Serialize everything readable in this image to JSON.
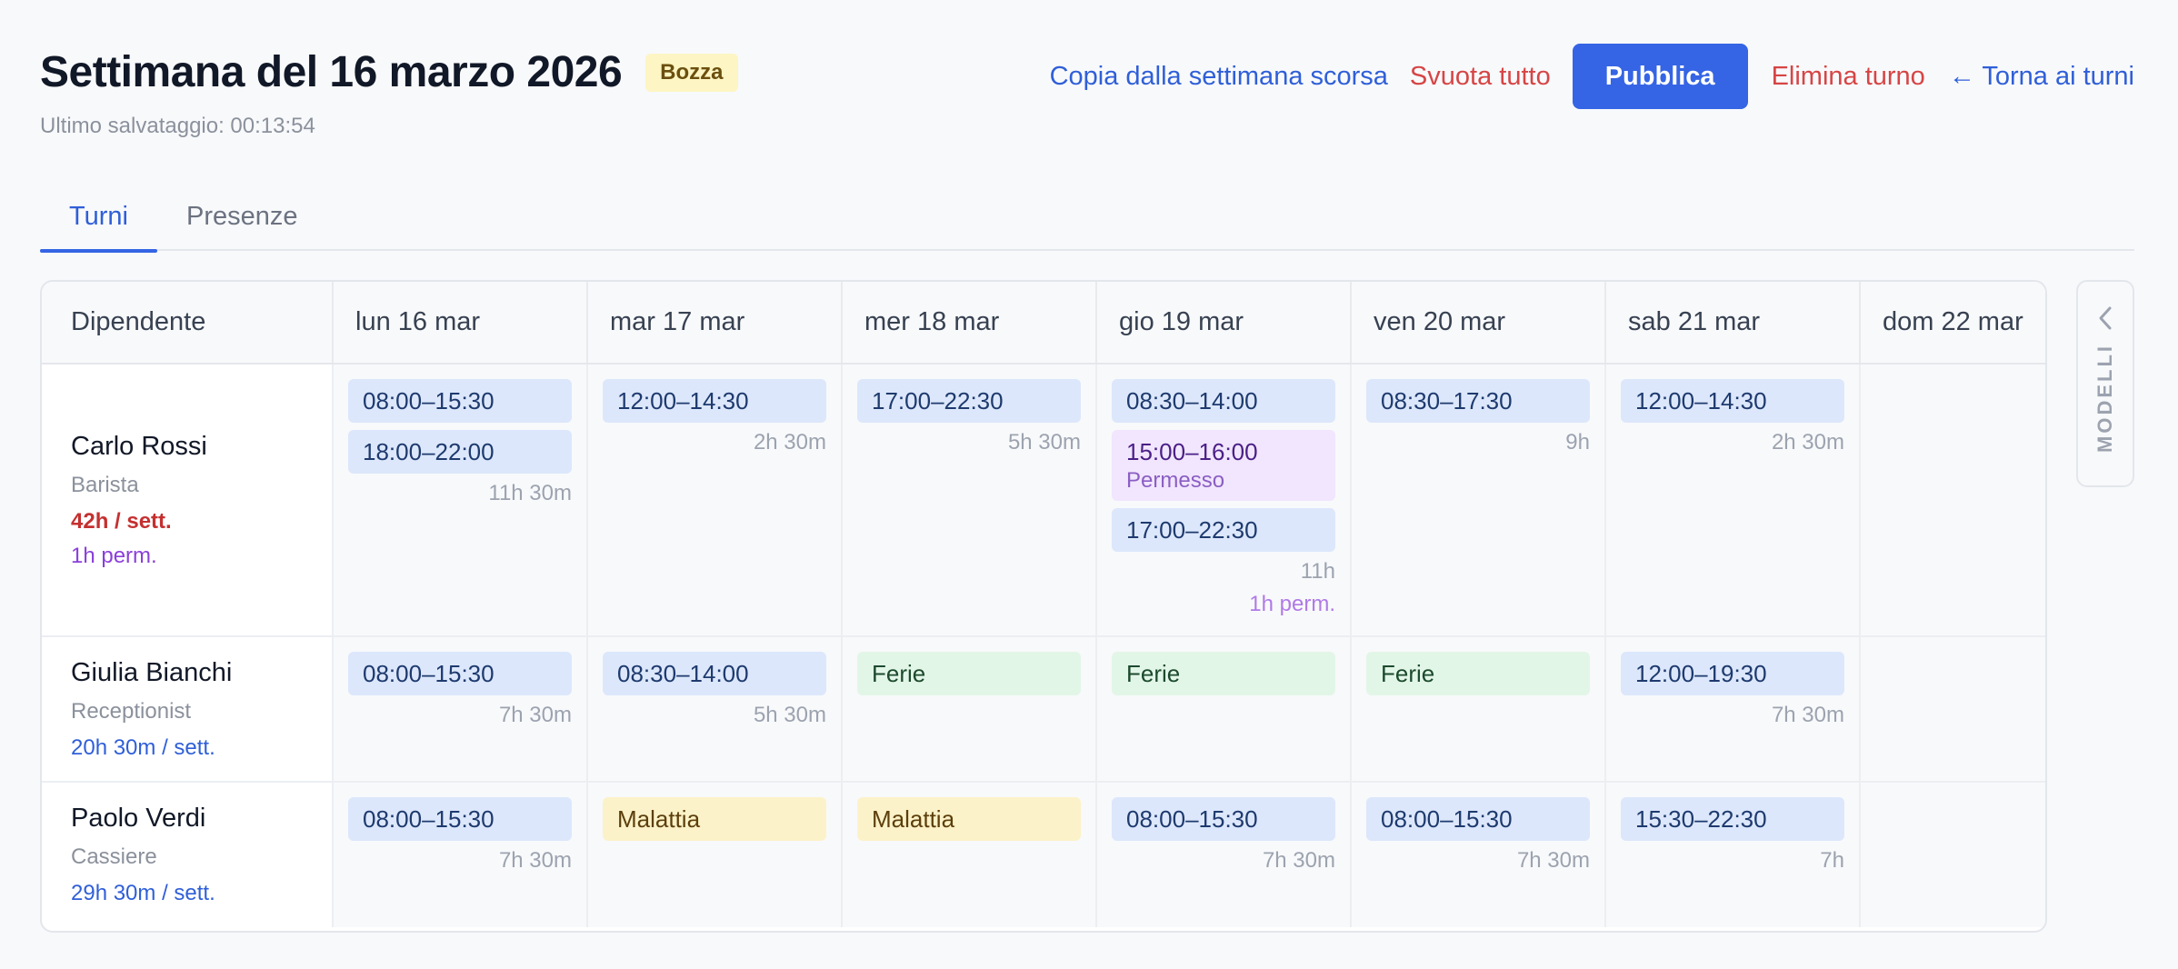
{
  "header": {
    "title": "Settimana del 16 marzo 2026",
    "badge": "Bozza",
    "last_saved": "Ultimo salvataggio: 00:13:54",
    "actions": {
      "copy": "Copia dalla settimana scorsa",
      "clear": "Svuota tutto",
      "publish": "Pubblica",
      "delete": "Elimina turno",
      "back": "← Torna ai turni"
    }
  },
  "tabs": [
    {
      "label": "Turni",
      "active": true
    },
    {
      "label": "Presenze",
      "active": false
    }
  ],
  "grid": {
    "employee_header": "Dipendente",
    "days": [
      "lun 16 mar",
      "mar 17 mar",
      "mer 18 mar",
      "gio 19 mar",
      "ven 20 mar",
      "sab 21 mar",
      "dom 22 mar"
    ]
  },
  "employees": [
    {
      "name": "Carlo Rossi",
      "role": "Barista",
      "weekly": "42h / sett.",
      "perm": "1h perm.",
      "days": [
        {
          "shifts": [
            {
              "label": "08:00–15:30",
              "kind": "work"
            },
            {
              "label": "18:00–22:00",
              "kind": "work"
            }
          ],
          "total": "11h 30m"
        },
        {
          "shifts": [
            {
              "label": "12:00–14:30",
              "kind": "work"
            }
          ],
          "total": "2h 30m"
        },
        {
          "shifts": [
            {
              "label": "17:00–22:30",
              "kind": "work"
            }
          ],
          "total": "5h 30m"
        },
        {
          "shifts": [
            {
              "label": "08:30–14:00",
              "kind": "work"
            },
            {
              "label": "15:00–16:00",
              "kind": "perm",
              "sub": "Permesso"
            },
            {
              "label": "17:00–22:30",
              "kind": "work"
            }
          ],
          "total": "11h",
          "perm_total": "1h perm."
        },
        {
          "shifts": [
            {
              "label": "08:30–17:30",
              "kind": "work"
            }
          ],
          "total": "9h"
        },
        {
          "shifts": [
            {
              "label": "12:00–14:30",
              "kind": "work"
            }
          ],
          "total": "2h 30m"
        },
        {
          "shifts": [],
          "total": ""
        }
      ]
    },
    {
      "name": "Giulia Bianchi",
      "role": "Receptionist",
      "weekly": "20h 30m / sett.",
      "days": [
        {
          "shifts": [
            {
              "label": "08:00–15:30",
              "kind": "work"
            }
          ],
          "total": "7h 30m"
        },
        {
          "shifts": [
            {
              "label": "08:30–14:00",
              "kind": "work"
            }
          ],
          "total": "5h 30m"
        },
        {
          "shifts": [
            {
              "label": "Ferie",
              "kind": "vac"
            }
          ],
          "total": ""
        },
        {
          "shifts": [
            {
              "label": "Ferie",
              "kind": "vac"
            }
          ],
          "total": ""
        },
        {
          "shifts": [
            {
              "label": "Ferie",
              "kind": "vac"
            }
          ],
          "total": ""
        },
        {
          "shifts": [
            {
              "label": "12:00–19:30",
              "kind": "work"
            }
          ],
          "total": "7h 30m"
        },
        {
          "shifts": [],
          "total": ""
        }
      ]
    },
    {
      "name": "Paolo Verdi",
      "role": "Cassiere",
      "weekly": "29h 30m / sett.",
      "days": [
        {
          "shifts": [
            {
              "label": "08:00–15:30",
              "kind": "work"
            }
          ],
          "total": "7h 30m"
        },
        {
          "shifts": [
            {
              "label": "Malattia",
              "kind": "sick"
            }
          ],
          "total": ""
        },
        {
          "shifts": [
            {
              "label": "Malattia",
              "kind": "sick"
            }
          ],
          "total": ""
        },
        {
          "shifts": [
            {
              "label": "08:00–15:30",
              "kind": "work"
            }
          ],
          "total": "7h 30m"
        },
        {
          "shifts": [
            {
              "label": "08:00–15:30",
              "kind": "work"
            }
          ],
          "total": "7h 30m"
        },
        {
          "shifts": [
            {
              "label": "15:30–22:30",
              "kind": "work"
            }
          ],
          "total": "7h"
        },
        {
          "shifts": [],
          "total": ""
        }
      ]
    }
  ],
  "side_panel": {
    "label": "MODELLI",
    "icon": "chevron-left-icon"
  },
  "colors": {
    "accent": "#3565e5",
    "danger": "#d64545",
    "link": "#2f5fd8"
  }
}
